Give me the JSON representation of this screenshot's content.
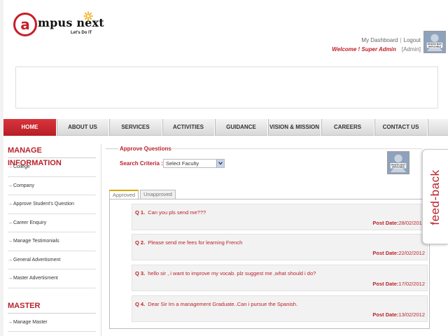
{
  "header": {
    "logo_text": "mpus next",
    "logo_tagline": "Let's Do IT",
    "links": {
      "dashboard": "My Dashboard",
      "separator": "|",
      "logout": "Logout"
    },
    "welcome": "Welcome ! Super Admin",
    "role": "[Admin]",
    "avatar_caption": "PHOTO NOT AVAILABLE"
  },
  "nav": {
    "items": [
      {
        "label": "HOME",
        "active": true
      },
      {
        "label": "ABOUT US",
        "active": false
      },
      {
        "label": "SERVICES",
        "active": false
      },
      {
        "label": "ACTIVITIES",
        "active": false
      },
      {
        "label": "GUIDANCE",
        "active": false
      },
      {
        "label": "VISION & MISSION",
        "active": false
      },
      {
        "label": "CAREERS",
        "active": false
      },
      {
        "label": "CONTACT US",
        "active": false
      }
    ]
  },
  "sidebar": {
    "section1_title": "MANAGE INFORMATION",
    "section1_items": [
      "College",
      "Company",
      "Approve Student's Question",
      "Career Enquiry",
      "Manage Testimonials",
      "General Advertisment",
      "Master Advertisment"
    ],
    "section2_title": "MASTER",
    "section2_items": [
      "Manage Master"
    ]
  },
  "main": {
    "title": "Approve Questions",
    "criteria_label": "Search Criteria :",
    "criteria_value": "Select Faculty",
    "tabs": [
      {
        "label": "Approved",
        "active": true
      },
      {
        "label": "Unapproved",
        "active": false
      }
    ],
    "post_date_label": "Post Date:",
    "questions": [
      {
        "num": "Q 1.",
        "text": "Can you pls send me???",
        "date": "28/02/2012"
      },
      {
        "num": "Q 2.",
        "text": "Please send me fees for learning French",
        "date": "22/02/2012"
      },
      {
        "num": "Q 3.",
        "text": "hello sir , i want to improve my vocab. plz suggest me ,what should i do?",
        "date": "17/02/2012"
      },
      {
        "num": "Q 4.",
        "text": "Dear Sir Im a management Graduate..Can i pursue the Spanish.",
        "date": "13/02/2012"
      }
    ]
  },
  "feedback_label": "feed-back",
  "colors": {
    "brand_red": "#b8232b",
    "nav_active": "#c62830"
  }
}
